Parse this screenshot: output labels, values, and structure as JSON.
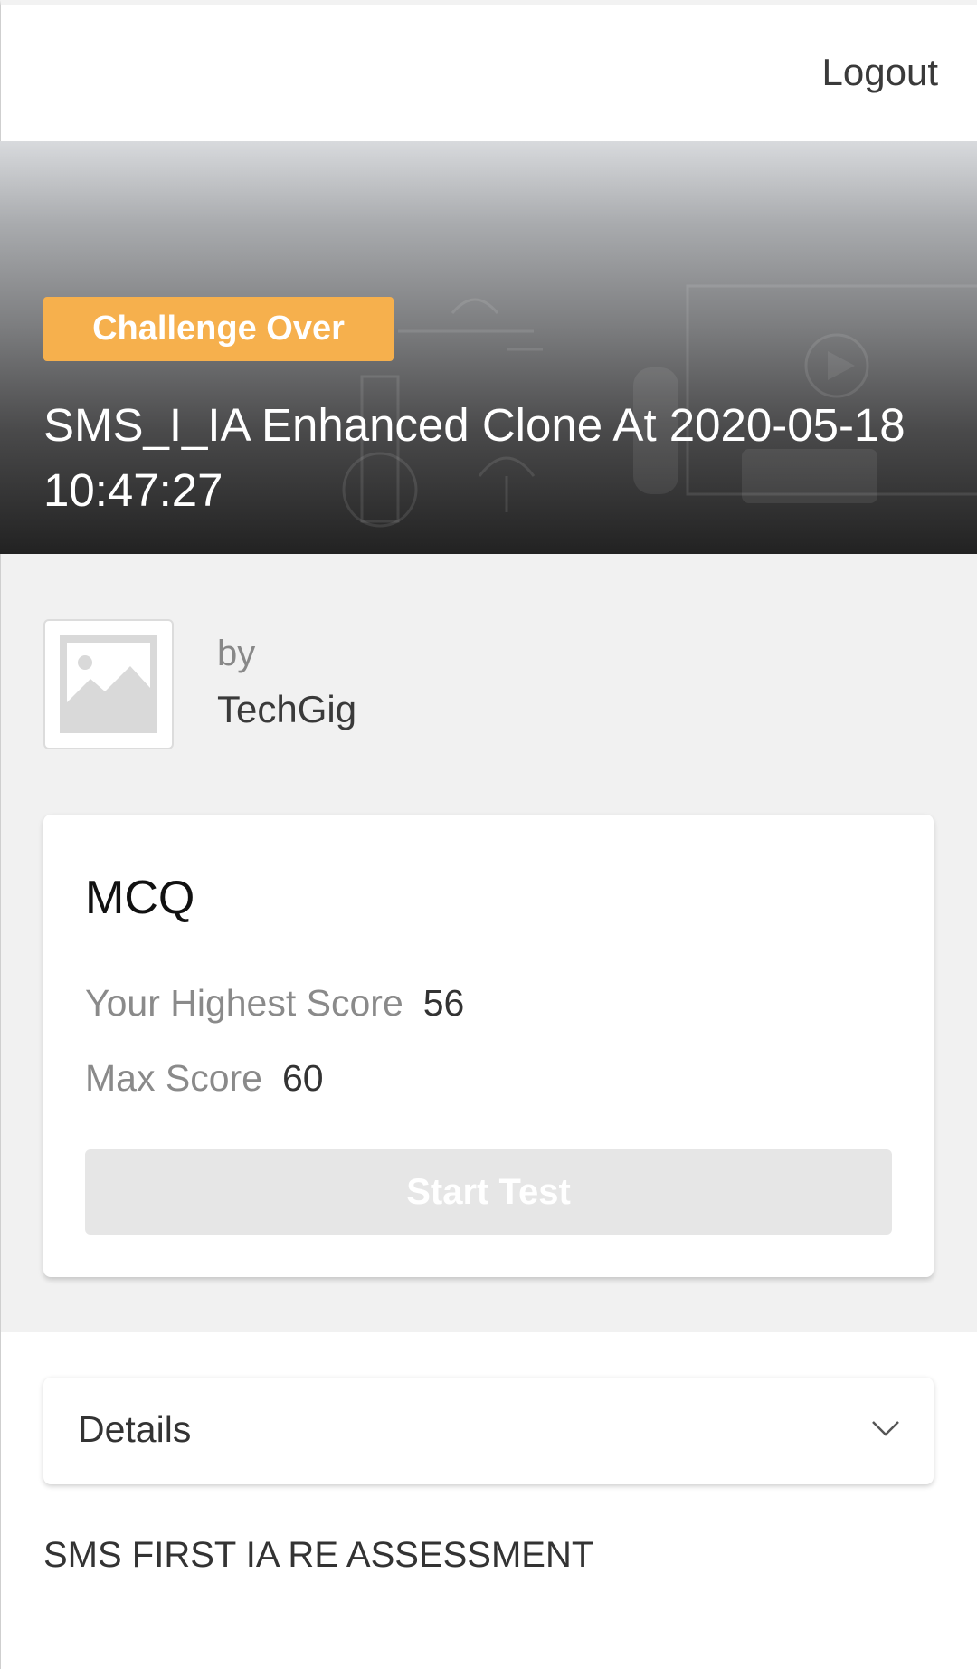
{
  "header": {
    "logout_label": "Logout"
  },
  "banner": {
    "status_badge": "Challenge Over",
    "title": "SMS_I_IA Enhanced Clone At 2020-05-18 10:47:27"
  },
  "organizer": {
    "by_label": "by",
    "name": "TechGig",
    "logo_icon": "image-placeholder-icon"
  },
  "test_card": {
    "title": "MCQ",
    "highest_score_label": "Your Highest Score",
    "highest_score_value": "56",
    "max_score_label": "Max Score",
    "max_score_value": "60",
    "start_button_label": "Start Test"
  },
  "details": {
    "label": "Details",
    "icon": "chevron-down-icon",
    "description": "SMS FIRST IA RE ASSESSMENT"
  },
  "colors": {
    "badge": "#f6b04d",
    "disabled_button": "#e6e6e6",
    "content_background": "#f1f1f1"
  }
}
